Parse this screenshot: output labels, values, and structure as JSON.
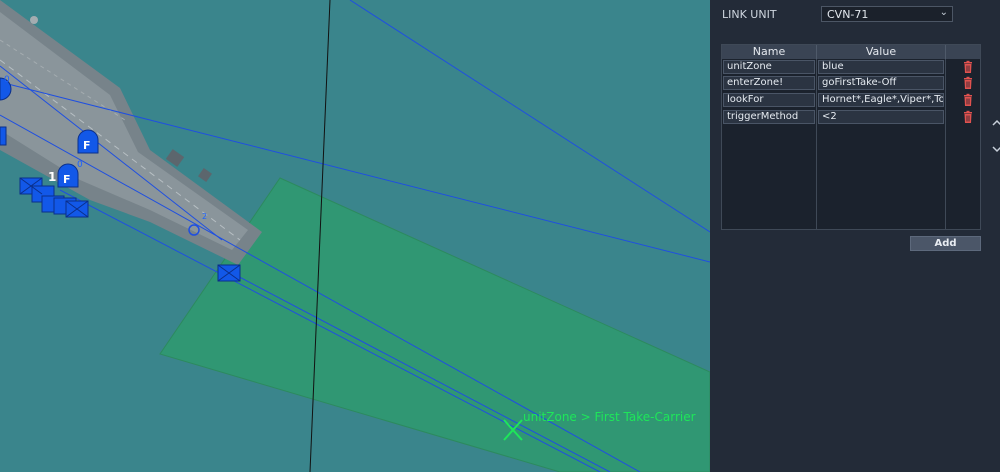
{
  "map": {
    "zone_label": "unitZone > First Take-Carrier",
    "unit_number": "1",
    "marker_letter": "F",
    "small_digit_a": "0",
    "small_digit_b": "2",
    "colors": {
      "water": "#3a858c",
      "zone": "#2f9a6e",
      "route": "#1f4fe0",
      "unit": "#1258e8",
      "label": "#1ee65a"
    }
  },
  "panel": {
    "link_unit_label": "LINK UNIT",
    "link_unit_value": "CVN-71",
    "table": {
      "headers": [
        "Name",
        "Value"
      ],
      "rows": [
        {
          "name": "unitZone",
          "value": "blue"
        },
        {
          "name": "enterZone!",
          "value": "goFirstTake-Off"
        },
        {
          "name": "lookFor",
          "value": "Hornet*,Eagle*,Viper*,Tomcat*"
        },
        {
          "name": "triggerMethod",
          "value": "<2"
        }
      ]
    },
    "add_label": "Add",
    "delete_icon": "trash-icon",
    "scroll_icons": [
      "chevron-up-icon",
      "chevron-down-icon"
    ]
  }
}
